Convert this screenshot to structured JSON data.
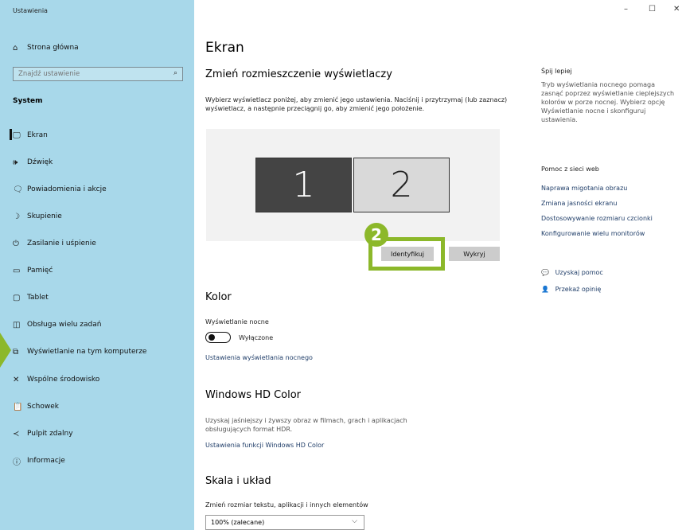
{
  "window": {
    "title": "Ustawienia",
    "minimize": "–",
    "maximize": "☐",
    "close": "✕"
  },
  "sidebar": {
    "home": "Strona główna",
    "search_placeholder": "Znajdź ustawienie",
    "section": "System",
    "items": [
      {
        "label": "Ekran",
        "icon": "monitor-icon",
        "glyph": "🖵"
      },
      {
        "label": "Dźwięk",
        "icon": "speaker-icon",
        "glyph": "🕪"
      },
      {
        "label": "Powiadomienia i akcje",
        "icon": "notification-icon",
        "glyph": "🗨"
      },
      {
        "label": "Skupienie",
        "icon": "moon-icon",
        "glyph": "☽"
      },
      {
        "label": "Zasilanie i uśpienie",
        "icon": "power-icon",
        "glyph": "⏻"
      },
      {
        "label": "Pamięć",
        "icon": "storage-icon",
        "glyph": "▭"
      },
      {
        "label": "Tablet",
        "icon": "tablet-icon",
        "glyph": "▢"
      },
      {
        "label": "Obsługa wielu zadań",
        "icon": "multitasking-icon",
        "glyph": "◫"
      },
      {
        "label": "Wyświetlanie na tym komputerze",
        "icon": "project-icon",
        "glyph": "⧉"
      },
      {
        "label": "Wspólne środowisko",
        "icon": "shared-experience-icon",
        "glyph": "✕"
      },
      {
        "label": "Schowek",
        "icon": "clipboard-icon",
        "glyph": "📋"
      },
      {
        "label": "Pulpit zdalny",
        "icon": "remote-desktop-icon",
        "glyph": "≺"
      },
      {
        "label": "Informacje",
        "icon": "info-icon",
        "glyph": "ⓘ"
      }
    ]
  },
  "main": {
    "title": "Ekran",
    "arrange_heading": "Zmień rozmieszczenie wyświetlaczy",
    "arrange_desc": "Wybierz wyświetlacz poniżej, aby zmienić jego ustawienia. Naciśnij i przytrzymaj (lub zaznacz) wyświetlacz, a następnie przeciągnij go, aby zmienić jego położenie.",
    "monitor1": "1",
    "monitor2": "2",
    "identify_button": "Identyfikuj",
    "detect_button": "Wykryj",
    "callout_number": "2",
    "color_heading": "Kolor",
    "night_light_label": "Wyświetlanie nocne",
    "night_light_state": "Wyłączone",
    "night_light_settings": "Ustawienia wyświetlania nocnego",
    "hdr_heading": "Windows HD Color",
    "hdr_desc": "Uzyskaj jaśniejszy i żywszy obraz w filmach, grach i aplikacjach obsługujących format HDR.",
    "hdr_settings": "Ustawienia funkcji Windows HD Color",
    "scale_heading": "Skala i układ",
    "scale_label": "Zmień rozmiar tekstu, aplikacji i innych elementów",
    "scale_value": "100% (zalecane)"
  },
  "right": {
    "sleep_title": "Śpij lepiej",
    "sleep_desc": "Tryb wyświetlania nocnego pomaga zasnąć poprzez wyświetlanie cieplejszych kolorów w porze nocnej. Wybierz opcję Wyświetlanie nocne i skonfiguruj ustawienia.",
    "help_title": "Pomoc z sieci web",
    "help_links": [
      "Naprawa migotania obrazu",
      "Zmiana jasności ekranu",
      "Dostosowywanie rozmiaru czcionki",
      "Konfigurowanie wielu monitorów"
    ],
    "get_help": "Uzyskaj pomoc",
    "feedback": "Przekaż opinię"
  },
  "colors": {
    "accent": "#8cb82a",
    "sidebar": "#a8d8ea",
    "link": "#1f3d68"
  }
}
